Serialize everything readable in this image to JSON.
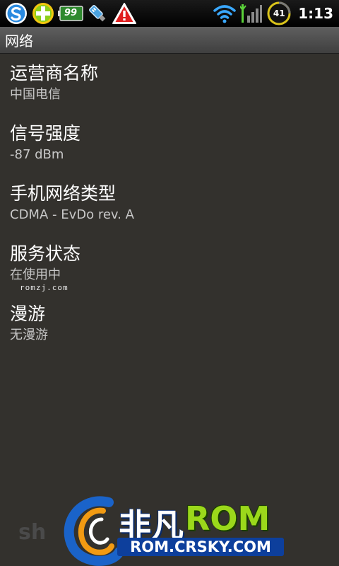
{
  "status_bar": {
    "clock": "1:13",
    "battery_level": "41",
    "notification_badge": "99",
    "icons": [
      "sogou-icon",
      "add-icon",
      "battery-notify-icon",
      "usb-icon",
      "warning-icon",
      "wifi-icon",
      "signal-icon",
      "battery-icon"
    ]
  },
  "title_bar": {
    "title": "网络"
  },
  "items": [
    {
      "title": "运营商名称",
      "value": "中国电信"
    },
    {
      "title": "信号强度",
      "value": "-87 dBm"
    },
    {
      "title": "手机网络类型",
      "value": "CDMA - EvDo rev. A"
    },
    {
      "title": "服务状态",
      "value": "在使用中"
    },
    {
      "title": "漫游",
      "value": "无漫游"
    }
  ],
  "watermarks": {
    "small": "romzj.com",
    "brand_cn": "非凡",
    "brand_rom": "ROM",
    "url": "ROM.CRSKY.COM",
    "shadow_text": "sh"
  },
  "colors": {
    "background": "#33312d",
    "title_bar": "#4f4f4f",
    "secondary_text": "#c8c8c8",
    "wifi": "#3aa8ff",
    "signal": "#5bd23a"
  }
}
